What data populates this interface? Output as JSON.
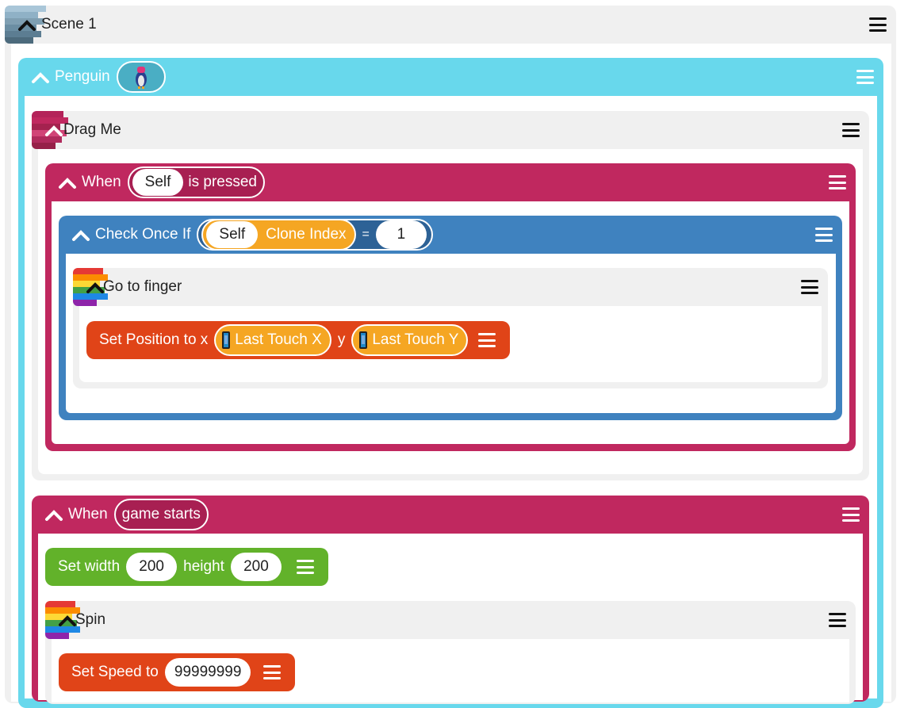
{
  "scene": {
    "title": "Scene 1"
  },
  "sprite": {
    "name": "Penguin",
    "avatar": "penguin-avatar"
  },
  "drag_me": {
    "title": "Drag Me",
    "when_block": {
      "when": "When",
      "target": "Self",
      "event": "is pressed"
    },
    "check_block": {
      "label": "Check Once If",
      "left": "Self",
      "property": "Clone Index",
      "operator": "=",
      "right": "1"
    },
    "go_to_finger": {
      "title": "Go to finger",
      "set_position": {
        "label": "Set Position to x",
        "x_value": "Last Touch X",
        "y_label": "y",
        "y_value": "Last Touch Y"
      }
    }
  },
  "game_start": {
    "when": "When",
    "event": "game starts",
    "set_size": {
      "label": "Set width",
      "width": "200",
      "height_label": "height",
      "height": "200"
    },
    "spin": {
      "title": "Spin",
      "set_speed": {
        "label": "Set Speed to",
        "value": "99999999"
      }
    }
  },
  "colors": {
    "scene_bg": "#f0f0f0",
    "sprite_blue": "#68d8ec",
    "when_crimson": "#c0285f",
    "check_blue": "#3f82bf",
    "motion_orange": "#e04418",
    "size_green": "#62b22a",
    "variable_yellow": "#f5a623"
  }
}
